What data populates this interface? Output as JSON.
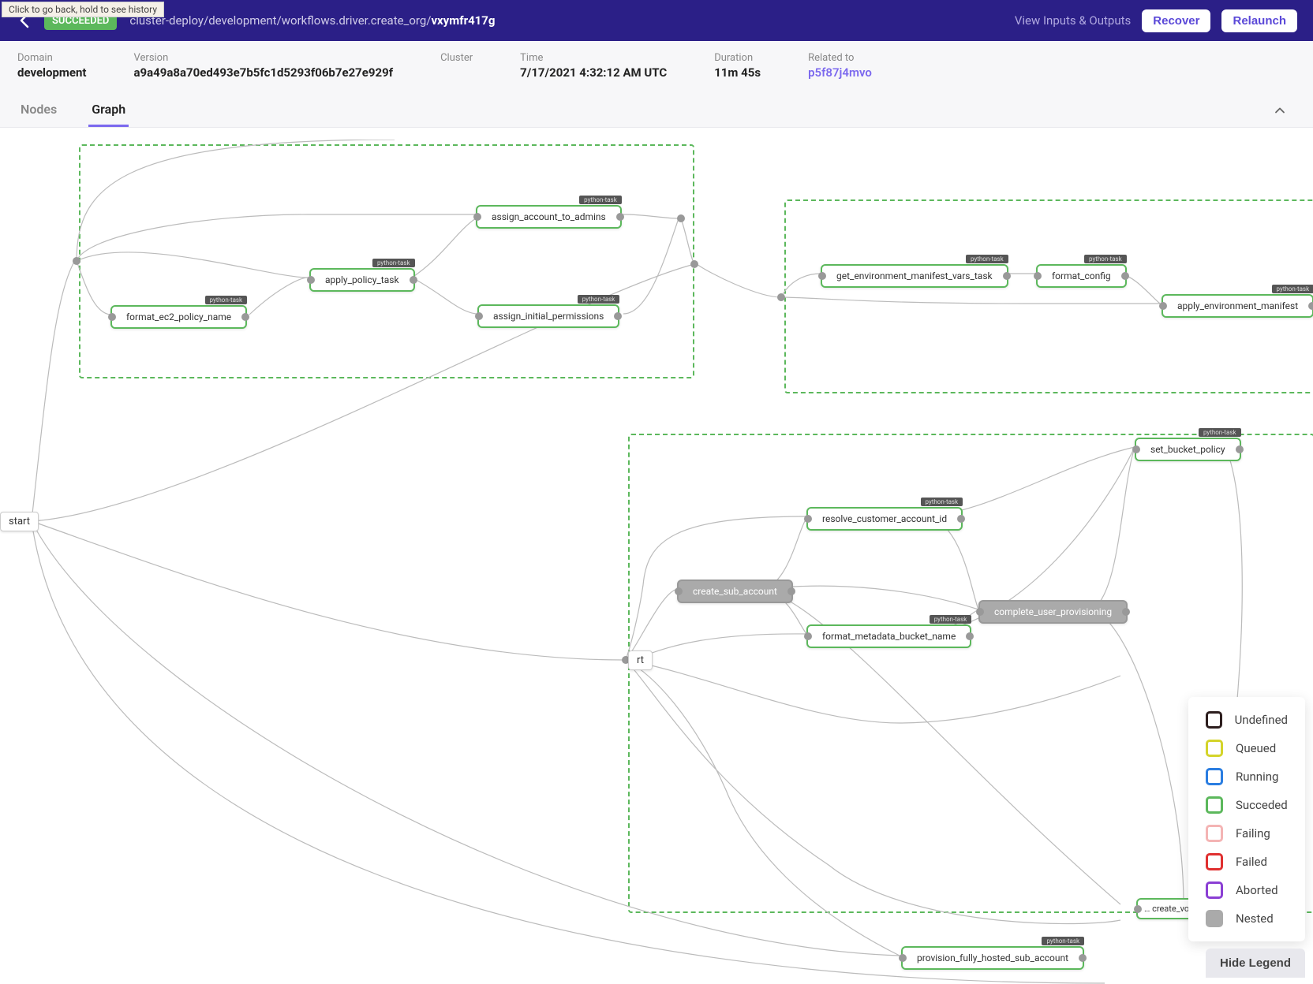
{
  "tooltip": "Click to go back, hold to see history",
  "header": {
    "status": "SUCCEEDED",
    "breadcrumb_prefix": "cluster-deploy/development/workflows.driver.create_org/",
    "run_id": "vxymfr417g",
    "view_io": "View Inputs & Outputs",
    "recover": "Recover",
    "relaunch": "Relaunch"
  },
  "meta": {
    "domain_label": "Domain",
    "domain_value": "development",
    "version_label": "Version",
    "version_value": "a9a49a8a70ed493e7b5fc1d5293f06b7e27e929f",
    "cluster_label": "Cluster",
    "cluster_value": "",
    "time_label": "Time",
    "time_value": "7/17/2021 4:32:12 AM UTC",
    "duration_label": "Duration",
    "duration_value": "11m 45s",
    "related_label": "Related to",
    "related_value": "p5f87j4mvo"
  },
  "tabs": {
    "nodes": "Nodes",
    "graph": "Graph"
  },
  "nodes": {
    "start": "start",
    "rt": "rt",
    "fmt_ec2": "format_ec2_policy_name",
    "apply_policy": "apply_policy_task",
    "assign_admins": "assign_account_to_admins",
    "assign_perms": "assign_initial_permissions",
    "get_env": "get_environment_manifest_vars_task",
    "fmt_config": "format_config",
    "apply_env": "apply_environment_manifest",
    "resolve_cust": "resolve_customer_account_id",
    "create_sub": "create_sub_account",
    "fmt_meta": "format_metadata_bucket_name",
    "complete_user": "complete_user_provisioning",
    "set_bucket": "set_bucket_policy",
    "provision": "provision_fully_hosted_sub_account",
    "partial_create": "… create_volu…",
    "tasktag": "python-task"
  },
  "legend": {
    "undefined": "Undefined",
    "queued": "Queued",
    "running": "Running",
    "succeded": "Succeded",
    "failing": "Failing",
    "failed": "Failed",
    "aborted": "Aborted",
    "nested": "Nested",
    "hide": "Hide Legend"
  },
  "colors": {
    "header_bg": "#2b1f87",
    "accent": "#7b68ee",
    "success": "#5cb85c",
    "undefined": "#2d1e1e",
    "queued": "#d4d42a",
    "running": "#2a7de1",
    "failing": "#f4b4b4",
    "failed": "#e03030",
    "aborted": "#8b3fd4",
    "nested": "#aaaaaa"
  }
}
